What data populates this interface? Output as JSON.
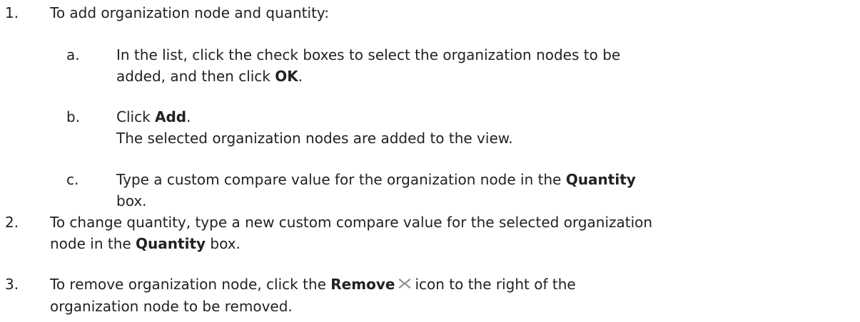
{
  "steps": [
    {
      "number": "1.",
      "text": "To add organization node and quantity:",
      "substeps": [
        {
          "letter": "a.",
          "line1": "In the list, click the check boxes to select the organization nodes to be",
          "line2_pre": "added, and then click ",
          "line2_bold": "OK",
          "line2_post": "."
        },
        {
          "letter": "b.",
          "line1_pre": "Click ",
          "line1_bold": "Add",
          "line1_post": ".",
          "line2": "The selected organization nodes are added to the view."
        },
        {
          "letter": "c.",
          "line1_pre": "Type a custom compare value for the organization node in the ",
          "line1_bold": "Quantity",
          "line2": "box."
        }
      ]
    },
    {
      "number": "2.",
      "line1": "To change quantity, type a new custom compare value for the selected organization",
      "line2_pre": "node in the ",
      "line2_bold": "Quantity",
      "line2_post": " box."
    },
    {
      "number": "3.",
      "line1_pre": "To remove organization node, click the ",
      "line1_bold": "Remove",
      "icon": "remove-x-icon",
      "line1_post": "icon to the right of the",
      "line2": "organization node to be removed."
    }
  ]
}
